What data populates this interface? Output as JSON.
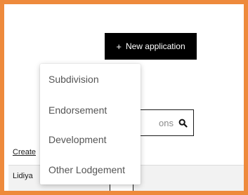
{
  "toolbar": {
    "new_application_label": "New application",
    "new_application_icon": "plus-icon"
  },
  "search": {
    "value": "ons",
    "icon": "search-icon"
  },
  "table": {
    "header_link": "Create",
    "rows": [
      {
        "name": "Lidiya"
      }
    ]
  },
  "dropdown": {
    "items": [
      {
        "label": "Subdivision"
      },
      {
        "label": "Endorsement"
      },
      {
        "label": "Development"
      },
      {
        "label": "Other Lodgement"
      }
    ]
  },
  "colors": {
    "frame_border": "#ee8a3c",
    "button_bg": "#000000",
    "button_text": "#ffffff",
    "menu_text": "#555555",
    "row_bg": "#f2f2f2"
  }
}
